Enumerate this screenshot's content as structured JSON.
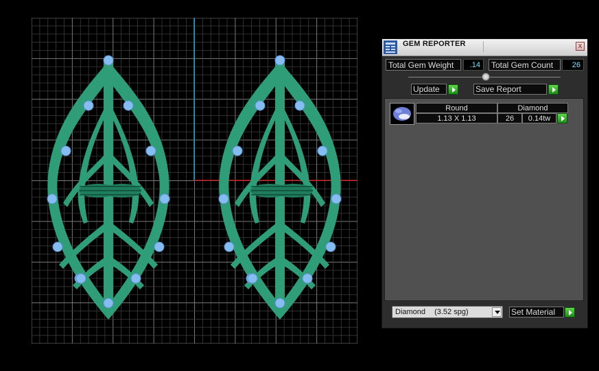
{
  "panel": {
    "title": "GEM REPORTER",
    "close_label": "x",
    "total_gem_weight_label": "Total Gem Weight",
    "total_gem_weight_value": ".14",
    "total_gem_count_label": "Total Gem Count",
    "total_gem_count_value": "26",
    "update_label": "Update",
    "save_report_label": "Save Report",
    "gem_row": {
      "shape": "Round",
      "material": "Diamond",
      "size": "1.13 X 1.13",
      "count": "26",
      "weight": "0.14tw"
    },
    "material_select": {
      "name": "Diamond",
      "density": "(3.52 spg)"
    },
    "set_material_label": "Set Material"
  },
  "colors": {
    "model": "#2f9e78",
    "gem": "#86bdf0",
    "grid": "#5a5a5a",
    "axis_vertical": "#1aa3c4",
    "axis_horizontal": "#c41a1a",
    "accent_button": "#2db02a"
  }
}
